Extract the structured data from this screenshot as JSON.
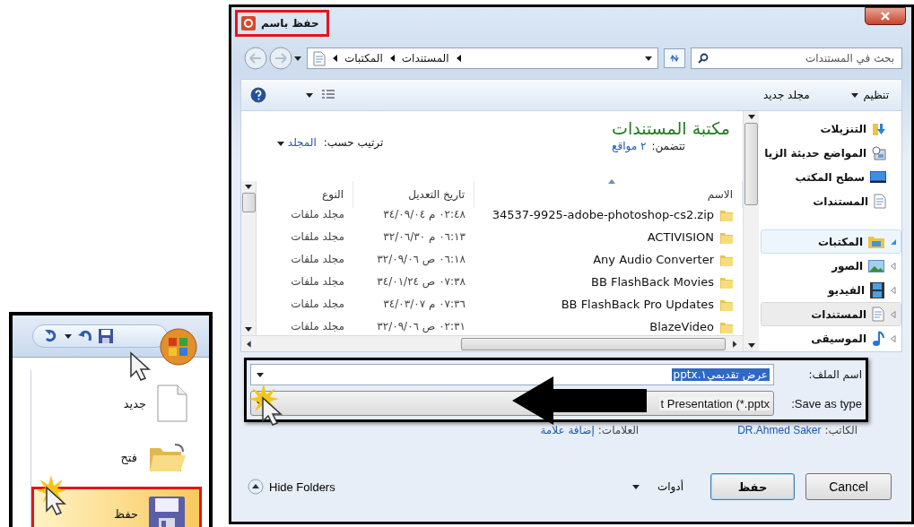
{
  "inset": {
    "menu": [
      {
        "label": "جديد",
        "kind": "new",
        "selected": false
      },
      {
        "label": "فتح",
        "kind": "open",
        "selected": false
      },
      {
        "label": "حفظ",
        "kind": "save",
        "selected": true
      }
    ]
  },
  "dialog": {
    "title": "حفظ باسم",
    "breadcrumb": [
      "المستندات",
      "المكتبات"
    ],
    "search": {
      "placeholder": "بحث في المستندات"
    },
    "toolbar": {
      "organize": "تنظيم",
      "new_folder": "مجلد جديد"
    },
    "library": {
      "title": "مكتبة المستندات",
      "includes_label": "تتضمن:",
      "includes_value": "٢ مواقع",
      "arrange_label": "ترتيب حسب:",
      "arrange_value": "المجلد"
    },
    "table": {
      "columns": [
        "الاسم",
        "تاريخ التعديل",
        "النوع"
      ],
      "rows": [
        {
          "name": "34537-9925-adobe-photoshop-cs2.zip",
          "date": "٠٢:٤٨ م ٣٤/٠٩/٠٤",
          "type": "مجلد ملفات"
        },
        {
          "name": "ACTIVISION",
          "date": "٠٦:١٣ م ٣٢/٠٦/٣٠",
          "type": "مجلد ملفات"
        },
        {
          "name": "Any Audio Converter",
          "date": "٠٦:١٨ ص ٣٢/٠٩/٠٦",
          "type": "مجلد ملفات"
        },
        {
          "name": "BB FlashBack Movies",
          "date": "٠٧:٣٨ ص ٣٤/٠١/٢٤",
          "type": "مجلد ملفات"
        },
        {
          "name": "BB FlashBack Pro Updates",
          "date": "٠٧:٣٦ م ٣٤/٠٣/٠٧",
          "type": "مجلد ملفات"
        },
        {
          "name": "BlazeVideo",
          "date": "٠٢:٣١ ص ٣٢/٠٩/٠٦",
          "type": "مجلد ملفات"
        }
      ]
    },
    "navigation": {
      "favorites": [
        {
          "label": "التنزيلات",
          "kind": "downloads"
        },
        {
          "label": "المواضع حديثة الزيا",
          "kind": "recent"
        },
        {
          "label": "سطح المكتب",
          "kind": "desktop"
        },
        {
          "label": "المستندات",
          "kind": "documents"
        }
      ],
      "libraries": {
        "label": "المكتبات",
        "expanded": true,
        "hovered": true,
        "children": [
          {
            "label": "الصور",
            "kind": "pictures",
            "selected": false
          },
          {
            "label": "الفيديو",
            "kind": "videos",
            "selected": false
          },
          {
            "label": "المستندات",
            "kind": "documents",
            "selected": true
          },
          {
            "label": "الموسيقى",
            "kind": "music",
            "selected": false
          }
        ]
      }
    },
    "file_name": {
      "label": "اسم الملف:",
      "value": "عرض تقديمي١.pptx"
    },
    "save_as_type": {
      "label": "Save as type:",
      "value": "t Presentation (*.pptx"
    },
    "authors": {
      "label": "الكاتب:",
      "value": "DR.Ahmed Saker"
    },
    "tags": {
      "label": "العلامات:",
      "value": "إضافة علامة"
    },
    "hide_folders": "Hide Folders",
    "tools": "أدوات",
    "save_button": "حفظ",
    "cancel_button": "Cancel"
  }
}
